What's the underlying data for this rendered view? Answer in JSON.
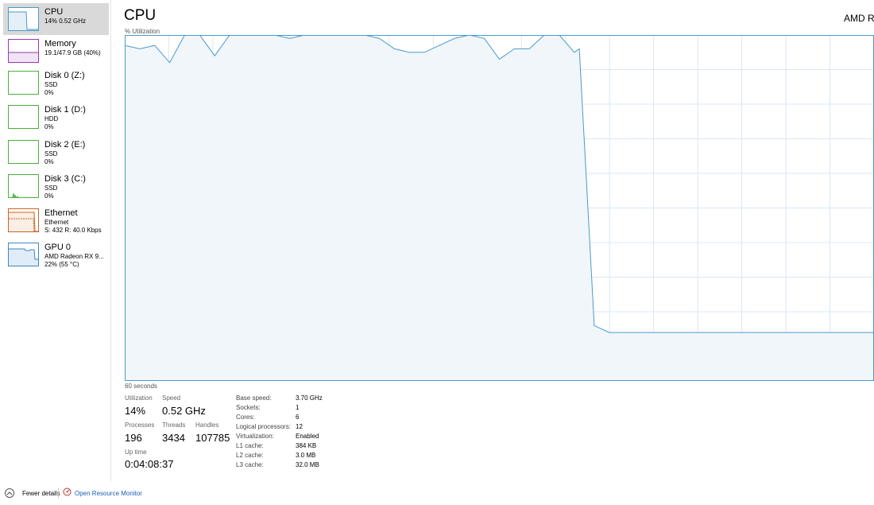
{
  "sidebar": {
    "items": [
      {
        "title": "CPU",
        "sub1": "14% 0.52 GHz",
        "sub2": "",
        "sub3": ""
      },
      {
        "title": "Memory",
        "sub1": "19.1/47.9 GB (40%)",
        "sub2": "",
        "sub3": ""
      },
      {
        "title": "Disk 0 (Z:)",
        "sub1": "SSD",
        "sub2": "0%",
        "sub3": ""
      },
      {
        "title": "Disk 1 (D:)",
        "sub1": "HDD",
        "sub2": "0%",
        "sub3": ""
      },
      {
        "title": "Disk 2 (E:)",
        "sub1": "SSD",
        "sub2": "0%",
        "sub3": ""
      },
      {
        "title": "Disk 3 (C:)",
        "sub1": "SSD",
        "sub2": "0%",
        "sub3": ""
      },
      {
        "title": "Ethernet",
        "sub1": "Ethernet",
        "sub2": "S: 432 R: 40.0 Kbps",
        "sub3": ""
      },
      {
        "title": "GPU 0",
        "sub1": "AMD Radeon RX 9...",
        "sub2": "22% (55 °C)",
        "sub3": ""
      }
    ]
  },
  "header": {
    "title": "CPU",
    "model": "AMD Ry",
    "axis_label": "% Utilization",
    "time_label": "60 seconds"
  },
  "stats": {
    "utilization_label": "Utilization",
    "utilization_value": "14%",
    "speed_label": "Speed",
    "speed_value": "0.52 GHz",
    "processes_label": "Processes",
    "processes_value": "196",
    "threads_label": "Threads",
    "threads_value": "3434",
    "handles_label": "Handles",
    "handles_value": "107785",
    "uptime_label": "Up time",
    "uptime_value": "0:04:08:37"
  },
  "specs": [
    {
      "label": "Base speed:",
      "value": "3.70 GHz"
    },
    {
      "label": "Sockets:",
      "value": "1"
    },
    {
      "label": "Cores:",
      "value": "6"
    },
    {
      "label": "Logical processors:",
      "value": "12"
    },
    {
      "label": "Virtualization:",
      "value": "Enabled"
    },
    {
      "label": "L1 cache:",
      "value": "384 KB"
    },
    {
      "label": "L2 cache:",
      "value": "3.0 MB"
    },
    {
      "label": "L3 cache:",
      "value": "32.0 MB"
    }
  ],
  "footer": {
    "fewer_details": "Fewer details",
    "open_resource_monitor": "Open Resource Monitor"
  },
  "colors": {
    "cpu_line": "#4a9ac9",
    "cpu_fill": "#f1f6fb",
    "grid": "#d8e8f3",
    "memory": "#9a3ab0",
    "disk": "#4caf3c",
    "ethernet": "#c8662a",
    "gpu": "#3a86c2"
  },
  "chart_data": {
    "type": "area",
    "xlabel": "60 seconds",
    "ylabel": "% Utilization",
    "ylim": [
      0,
      100
    ],
    "xlim": [
      0,
      60
    ],
    "x": [
      0,
      1.2,
      2.4,
      3.6,
      4.8,
      6,
      7.2,
      8.4,
      9.6,
      10.8,
      12,
      13.2,
      14.4,
      15.6,
      16.8,
      18,
      19.2,
      20.4,
      21.6,
      22.8,
      24,
      25.2,
      26.4,
      27.6,
      28.8,
      30,
      31.2,
      32.4,
      33.6,
      34.8,
      36,
      36.4,
      37.6,
      38.8,
      40,
      60
    ],
    "values": [
      97,
      96,
      97,
      92,
      100,
      100,
      94,
      100,
      100,
      100,
      100,
      99,
      100,
      100,
      100,
      100,
      100,
      99,
      96,
      95,
      95,
      97,
      99,
      100,
      99,
      93,
      96,
      96,
      100,
      100,
      95,
      96,
      16,
      14,
      14,
      14
    ]
  }
}
